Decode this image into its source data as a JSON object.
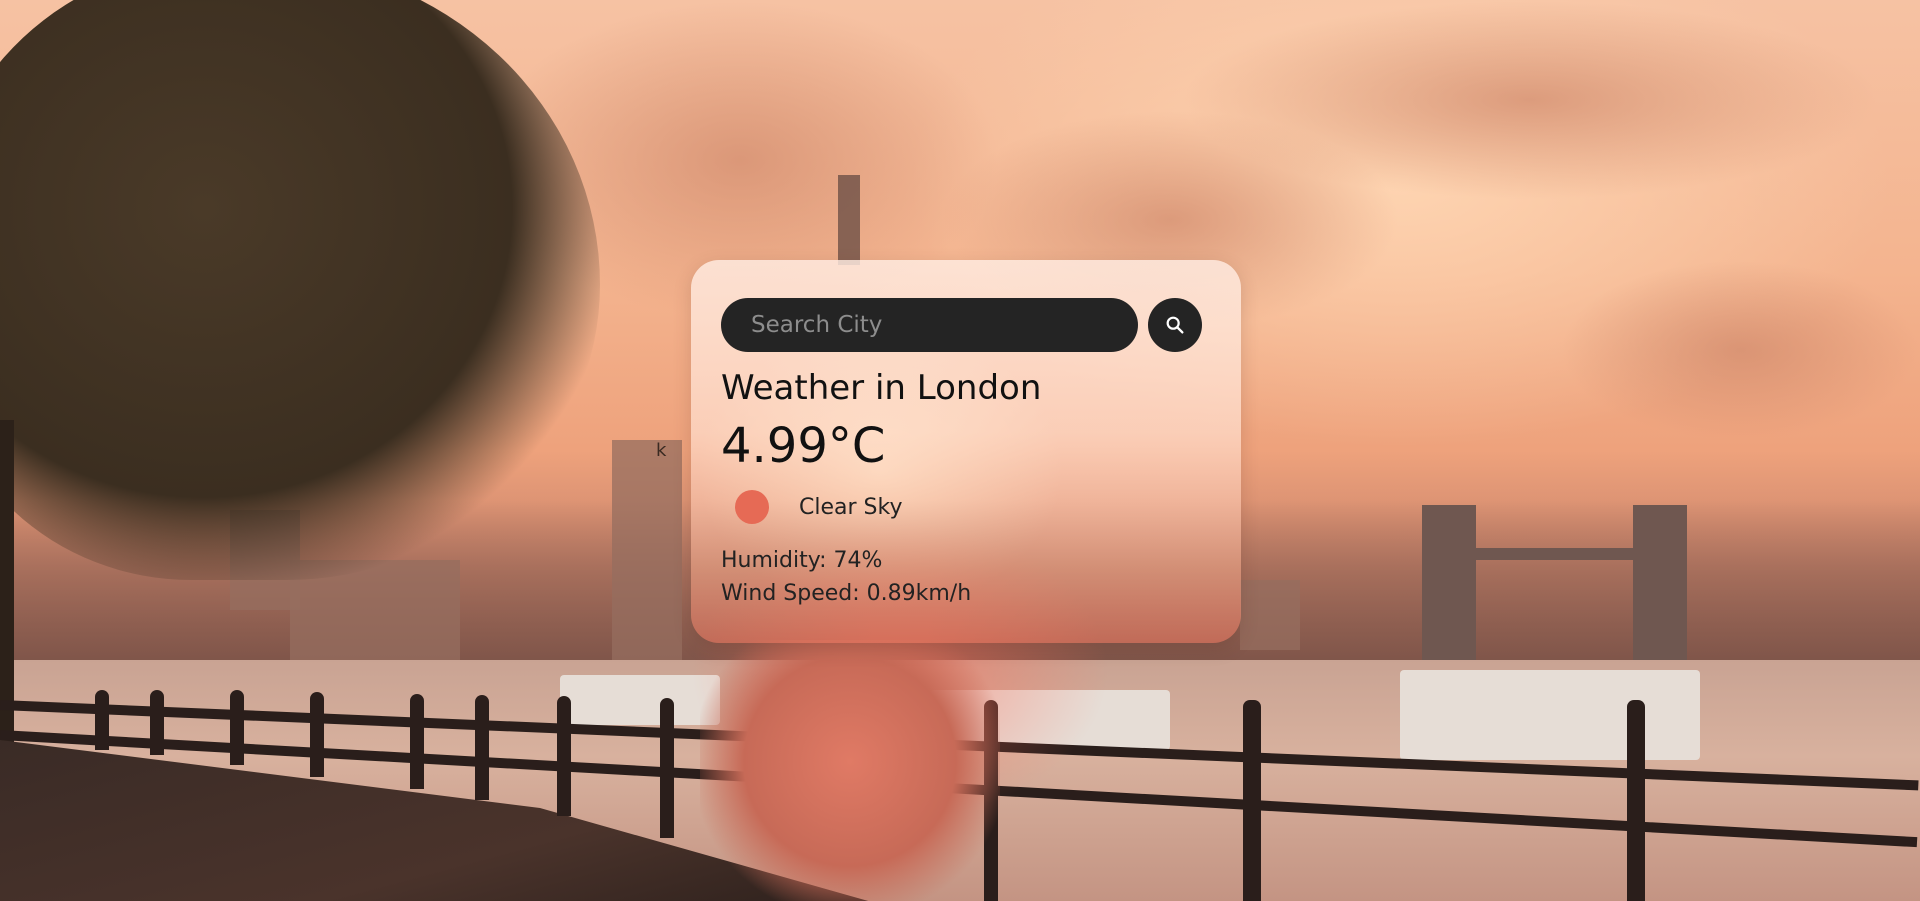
{
  "search": {
    "placeholder": "Search City",
    "value": "",
    "button_icon": "search-icon"
  },
  "weather": {
    "title": "Weather in London",
    "temperature": "4.99°C",
    "description": "Clear Sky",
    "description_icon": "clear-sky-icon",
    "humidity": "Humidity: 74%",
    "wind": "Wind Speed: 0.89km/h"
  },
  "stray_text": "k",
  "colors": {
    "search_bg": "#242424",
    "icon_accent": "#e66a55",
    "card_tint": "#ffe4d6"
  }
}
